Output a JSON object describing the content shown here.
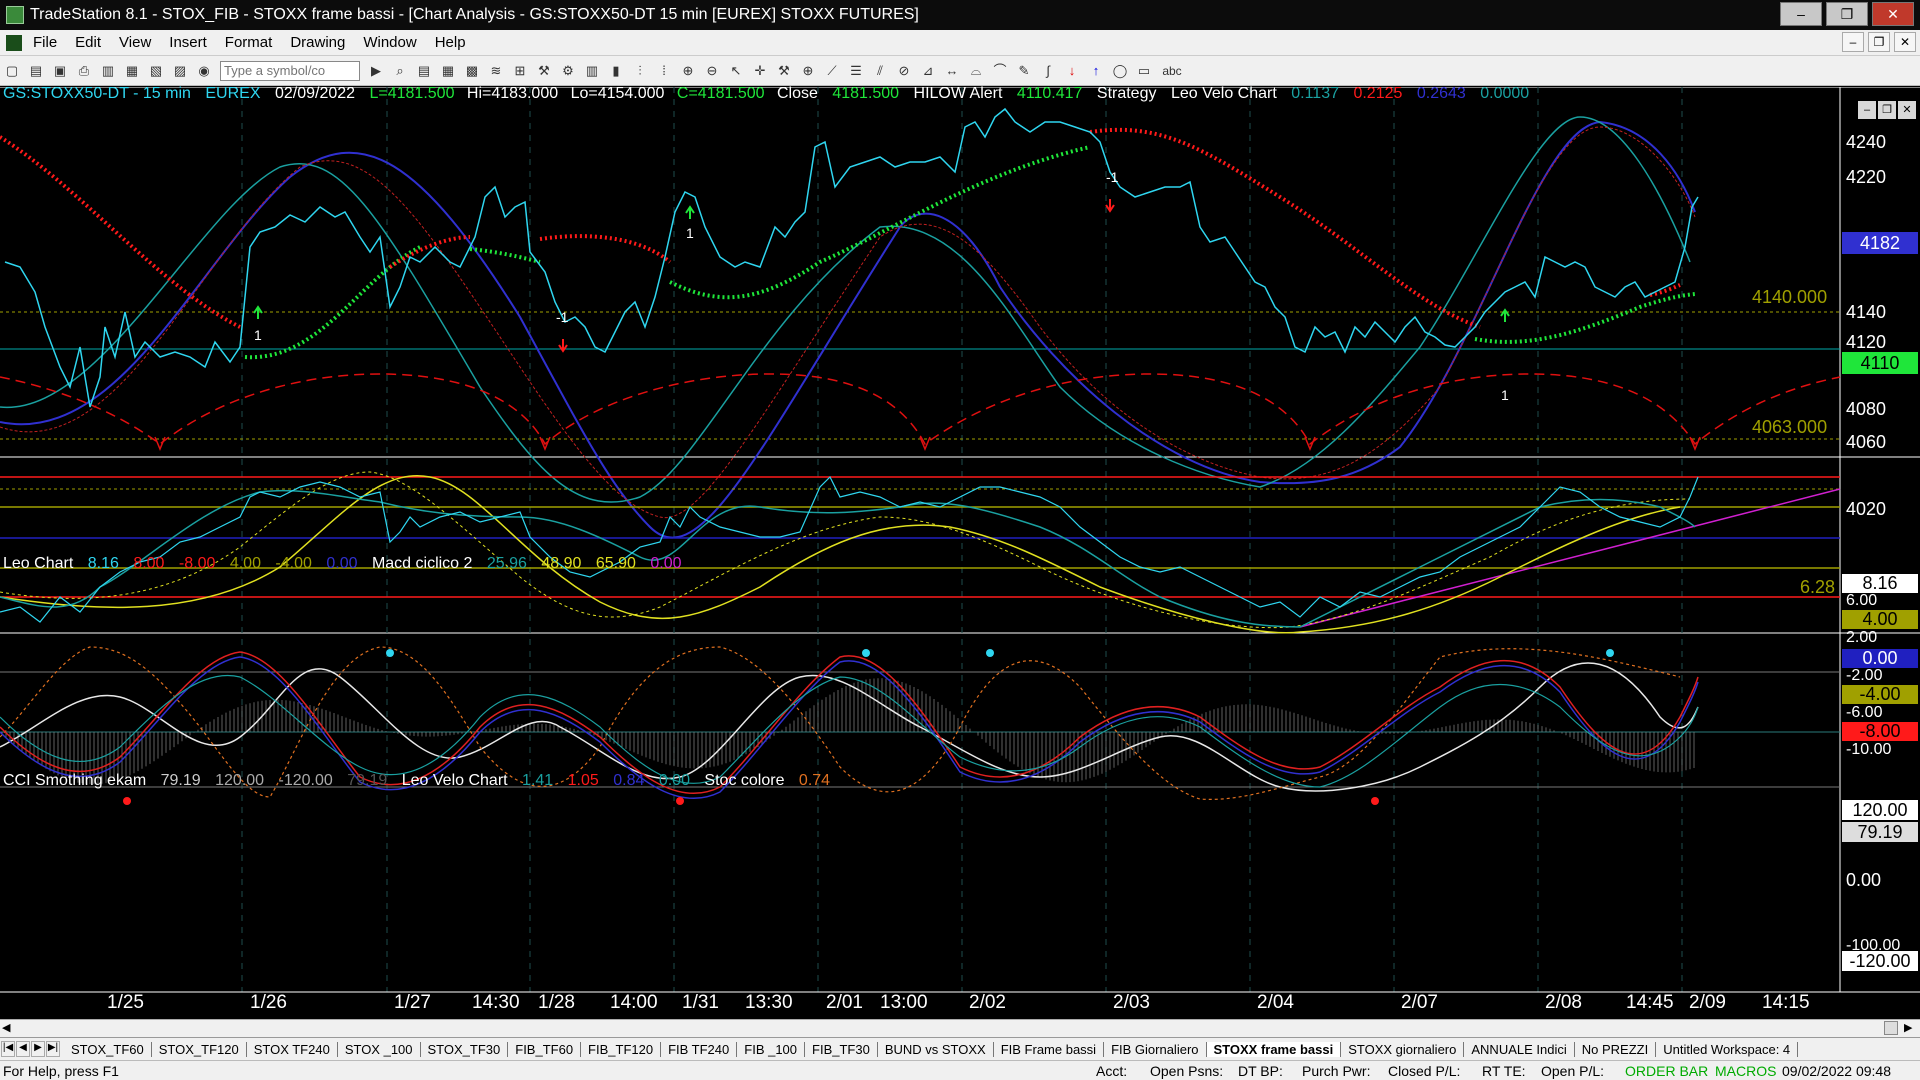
{
  "window": {
    "title": "TradeStation 8.1 - STOX_FIB - STOXX frame bassi - [Chart Analysis - GS:STOXX50-DT  15 min  [EUREX] STOXX FUTURES]",
    "buttons": [
      "–",
      "❐",
      "✕"
    ]
  },
  "menu": {
    "items": [
      "File",
      "Edit",
      "View",
      "Insert",
      "Format",
      "Drawing",
      "Window",
      "Help"
    ],
    "mdi_buttons": [
      "–",
      "❐",
      "✕"
    ]
  },
  "toolbar": {
    "symbol_placeholder": "Type a symbol/co",
    "abc_label": "abc"
  },
  "chart": {
    "header_price": {
      "symbol": "GS:STOXX50-DT - 15 min",
      "exchange": "EUREX",
      "date": "02/09/2022",
      "last": "L=4181.500",
      "high": "Hi=4183.000",
      "low": "Lo=4154.000",
      "close_c": "C=4181.500",
      "close_label": "Close",
      "close_value": "4181.500",
      "hilow_label": "HILOW Alert",
      "hilow_value": "4110.417",
      "strategy": "Strategy",
      "leo_velo": "Leo Velo Chart",
      "v1": "0.1137",
      "v2": "0.2125",
      "v3": "0.2643",
      "v4": "0.0000"
    },
    "header_mid": {
      "leo_chart": "Leo Chart",
      "v1": "8.16",
      "v2": "8.00",
      "v3": "-8.00",
      "v4": "4.00",
      "v5": "-4.00",
      "v6": "0.00",
      "macd": "Macd ciclico 2",
      "m1": "25.96",
      "m2": "48.90",
      "m3": "65.90",
      "m4": "0.00"
    },
    "header_low": {
      "cci": "CCI Smothing ekam",
      "c1": "79.19",
      "c2": "120.00",
      "c3": "-120.00",
      "c4": "79.19",
      "leo_velo": "Leo Velo Chart",
      "l1": "1.41",
      "l2": "1.05",
      "l3": "0.84",
      "l4": "0.00",
      "stoc": "Stoc colore",
      "s1": "0.74"
    },
    "price_axis": [
      "4240",
      "4220",
      "4182",
      "4140",
      "4120",
      "4110",
      "4080",
      "4060",
      "4020"
    ],
    "price_levels": {
      "upper": "4140.000",
      "lower": "4063.000"
    },
    "mid_axis": [
      "8.16",
      "6.00",
      "4.00",
      "2.00",
      "0.00",
      "-2.00",
      "-4.00",
      "-6.00",
      "-8.00",
      "-10.00"
    ],
    "mid_level": "6.28",
    "low_axis": [
      "120.00",
      "79.19",
      "0.00",
      "-100.00",
      "-120.00"
    ],
    "x_axis": [
      "1/25",
      "1/26",
      "1/27",
      "14:30",
      "1/28",
      "14:00",
      "1/31",
      "13:30",
      "2/01",
      "13:00",
      "2/02",
      "2/03",
      "2/04",
      "2/07",
      "2/08",
      "14:45",
      "2/09",
      "14:15"
    ],
    "signals": [
      "1",
      "1",
      "-1",
      "1",
      "-1",
      "1"
    ],
    "colors": {
      "bg": "#000000",
      "price": "#2fd6f0",
      "up": "#1fe63a",
      "down": "#ff1a1a",
      "level": "#a0a000",
      "accent_blue": "#2020c0",
      "magenta": "#d020d0"
    }
  },
  "tabs": {
    "items": [
      "STOX_TF60",
      "STOX_TF120",
      "STOX TF240",
      "STOX _100",
      "STOX_TF30",
      "FIB_TF60",
      "FIB_TF120",
      "FIB TF240",
      "FIB _100",
      "FIB_TF30",
      "BUND vs STOXX",
      "FIB Frame bassi",
      "FIB Giornaliero",
      "STOXX frame bassi",
      "STOXX giornaliero",
      "ANNUALE Indici",
      "No PREZZI",
      "Untitled Workspace: 4"
    ],
    "active": "STOXX frame bassi"
  },
  "status": {
    "help": "For Help, press F1",
    "acct": "Acct:",
    "open_psns": "Open Psns:",
    "dt_bp": "DT BP:",
    "purch": "Purch Pwr:",
    "closed": "Closed P/L:",
    "rt": "RT TE:",
    "open_pl": "Open P/L:",
    "order_bar": "ORDER BAR",
    "macros": "MACROS",
    "datetime": "09/02/2022 09:48"
  }
}
